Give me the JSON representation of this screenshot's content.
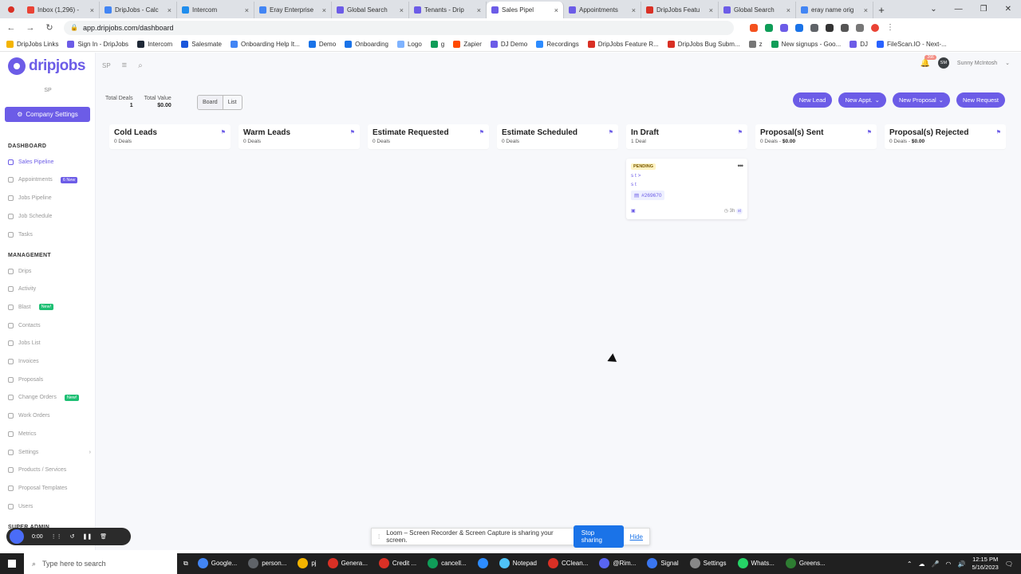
{
  "browser": {
    "tabs": [
      {
        "label": "",
        "color": "#d93025"
      },
      {
        "label": "Inbox (1,296) -",
        "color": "#ea4335"
      },
      {
        "label": "DripJobs - Calc",
        "color": "#4285f4"
      },
      {
        "label": "Intercom",
        "color": "#1f8ded"
      },
      {
        "label": "Eray Enterprise",
        "color": "#4285f4"
      },
      {
        "label": "Global Search",
        "color": "#6c5ce7"
      },
      {
        "label": "Tenants - Drip",
        "color": "#6c5ce7"
      },
      {
        "label": "Sales Pipel",
        "color": "#6c5ce7"
      },
      {
        "label": "Appointments",
        "color": "#6c5ce7"
      },
      {
        "label": "DripJobs Featu",
        "color": "#d93025"
      },
      {
        "label": "Global Search",
        "color": "#6c5ce7"
      },
      {
        "label": "eray name orig",
        "color": "#4285f4"
      }
    ],
    "url": "app.dripjobs.com/dashboard",
    "bookmarks": [
      {
        "label": "DripJobs Links",
        "color": "#f4b400"
      },
      {
        "label": "Sign In - DripJobs",
        "color": "#6c5ce7"
      },
      {
        "label": "Intercom",
        "color": "#1f2937"
      },
      {
        "label": "Salesmate",
        "color": "#1a56db"
      },
      {
        "label": "Onboarding Help It...",
        "color": "#4285f4"
      },
      {
        "label": "Demo",
        "color": "#1a73e8"
      },
      {
        "label": "Onboarding",
        "color": "#1a73e8"
      },
      {
        "label": "Logo",
        "color": "#7fb3ff"
      },
      {
        "label": "g",
        "color": "#0f9d58"
      },
      {
        "label": "Zapier",
        "color": "#ff4a00"
      },
      {
        "label": "DJ Demo",
        "color": "#6c5ce7"
      },
      {
        "label": "Recordings",
        "color": "#2d8cff"
      },
      {
        "label": "DripJobs Feature R...",
        "color": "#d93025"
      },
      {
        "label": "DripJobs Bug Subm...",
        "color": "#d93025"
      },
      {
        "label": "z",
        "color": "#777"
      },
      {
        "label": "New signups - Goo...",
        "color": "#0f9d58"
      },
      {
        "label": "DJ",
        "color": "#6c5ce7"
      },
      {
        "label": "FileScan.IO - Next-...",
        "color": "#2962ff"
      }
    ]
  },
  "app": {
    "logo_text": "dripjobs",
    "sp_initials": "SP",
    "sp_label": "SP",
    "company_settings": "Company Settings",
    "sections": {
      "dashboard": "DASHBOARD",
      "management": "MANAGEMENT",
      "super_admin": "SUPER ADMIN"
    },
    "dashboard_items": [
      {
        "label": "Sales Pipeline",
        "active": true,
        "badge": ""
      },
      {
        "label": "Appointments",
        "active": false,
        "badge": "6 New"
      },
      {
        "label": "Jobs Pipeline",
        "active": false,
        "badge": ""
      },
      {
        "label": "Job Schedule",
        "active": false,
        "badge": ""
      },
      {
        "label": "Tasks",
        "active": false,
        "badge": ""
      }
    ],
    "management_items": [
      {
        "label": "Drips",
        "badge": ""
      },
      {
        "label": "Activity",
        "badge": ""
      },
      {
        "label": "Blast",
        "badge": "New!"
      },
      {
        "label": "Contacts",
        "badge": ""
      },
      {
        "label": "Jobs List",
        "badge": ""
      },
      {
        "label": "Invoices",
        "badge": ""
      },
      {
        "label": "Proposals",
        "badge": ""
      },
      {
        "label": "Change Orders",
        "badge": "New!"
      },
      {
        "label": "Work Orders",
        "badge": ""
      },
      {
        "label": "Metrics",
        "badge": ""
      },
      {
        "label": "Settings",
        "badge": ""
      },
      {
        "label": "Products / Services",
        "badge": ""
      },
      {
        "label": "Proposal Templates",
        "badge": ""
      },
      {
        "label": "Users",
        "badge": ""
      }
    ],
    "notifications_count": "266",
    "user_initials": "SM",
    "user_name": "Sunny McIntosh",
    "summary": {
      "total_deals_label": "Total Deals",
      "total_deals_value": "1",
      "total_value_label": "Total Value",
      "total_value_value": "$0.00"
    },
    "view_toggle": {
      "board": "Board",
      "list": "List"
    },
    "actions": {
      "new_lead": "New Lead",
      "new_appt": "New Appt.",
      "new_proposal": "New Proposal",
      "new_request": "New Request"
    },
    "columns": [
      {
        "title": "Cold Leads",
        "deals": "0 Deals",
        "value": ""
      },
      {
        "title": "Warm Leads",
        "deals": "0 Deals",
        "value": ""
      },
      {
        "title": "Estimate Requested",
        "deals": "0 Deals",
        "value": ""
      },
      {
        "title": "Estimate Scheduled",
        "deals": "0 Deals",
        "value": ""
      },
      {
        "title": "In Draft",
        "deals": "1 Deal",
        "value": ""
      },
      {
        "title": "Proposal(s) Sent",
        "deals": "0 Deals",
        "value": "$0.00"
      },
      {
        "title": "Proposal(s) Rejected",
        "deals": "0 Deals",
        "value": "$0.00"
      }
    ],
    "card": {
      "status": "PENDING",
      "line1": "s t >",
      "line2": "s t",
      "id": "#269670",
      "age": "3h",
      "user": "st"
    }
  },
  "loom": {
    "timer": "0:00",
    "message": "Loom – Screen Recorder & Screen Capture is sharing your screen.",
    "stop_label": "Stop sharing",
    "hide_label": "Hide"
  },
  "taskbar": {
    "search_placeholder": "Type here to search",
    "apps": [
      {
        "label": "Google...",
        "color": "#4285f4"
      },
      {
        "label": "person...",
        "color": "#5f6368"
      },
      {
        "label": "pj",
        "color": "#f4b400"
      },
      {
        "label": "Genera...",
        "color": "#d93025"
      },
      {
        "label": "Credit ...",
        "color": "#d93025"
      },
      {
        "label": "cancell...",
        "color": "#0f9d58"
      },
      {
        "label": "",
        "color": "#2d8cff"
      },
      {
        "label": "Notepad",
        "color": "#4fc3f7"
      },
      {
        "label": "CClean...",
        "color": "#d93025"
      },
      {
        "label": "@Rim...",
        "color": "#5865f2"
      },
      {
        "label": "Signal",
        "color": "#3a76f0"
      },
      {
        "label": "Settings",
        "color": "#888"
      },
      {
        "label": "Whats...",
        "color": "#25d366"
      },
      {
        "label": "Greens...",
        "color": "#2e7d32"
      }
    ],
    "time": "12:15 PM",
    "date": "5/16/2023"
  }
}
